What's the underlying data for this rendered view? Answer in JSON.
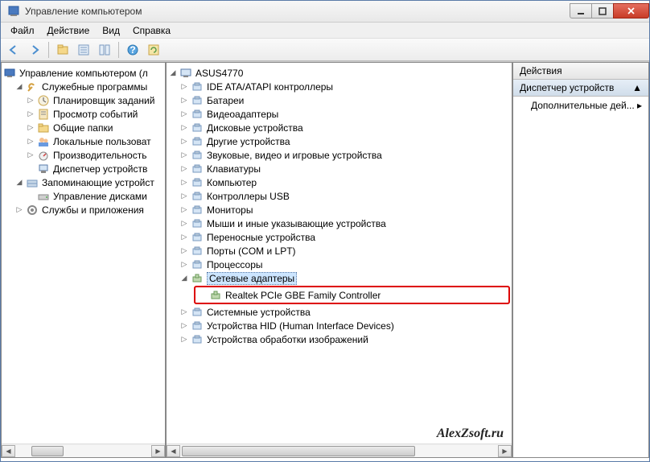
{
  "window": {
    "title": "Управление компьютером"
  },
  "menu": [
    "Файл",
    "Действие",
    "Вид",
    "Справка"
  ],
  "left_tree": {
    "root": "Управление компьютером (л",
    "groups": [
      {
        "label": "Служебные программы",
        "children": [
          "Планировщик заданий",
          "Просмотр событий",
          "Общие папки",
          "Локальные пользоват",
          "Производительность",
          "Диспетчер устройств"
        ]
      },
      {
        "label": "Запоминающие устройст",
        "children": [
          "Управление дисками"
        ]
      },
      {
        "label": "Службы и приложения",
        "children": []
      }
    ]
  },
  "device_tree": {
    "root": "ASUS4770",
    "categories": [
      "IDE ATA/ATAPI контроллеры",
      "Батареи",
      "Видеоадаптеры",
      "Дисковые устройства",
      "Другие устройства",
      "Звуковые, видео и игровые устройства",
      "Клавиатуры",
      "Компьютер",
      "Контроллеры USB",
      "Мониторы",
      "Мыши и иные указывающие устройства",
      "Переносные устройства",
      "Порты (COM и LPT)",
      "Процессоры"
    ],
    "expanded": {
      "label": "Сетевые адаптеры",
      "child": "Realtek PCIe GBE Family Controller"
    },
    "after": [
      "Системные устройства",
      "Устройства HID (Human Interface Devices)",
      "Устройства обработки изображений"
    ]
  },
  "actions": {
    "header": "Действия",
    "sub": "Диспетчер устройств",
    "item": "Дополнительные дей...",
    "arrow": "▲",
    "chev": "▸"
  },
  "watermark": "AlexZsoft.ru"
}
